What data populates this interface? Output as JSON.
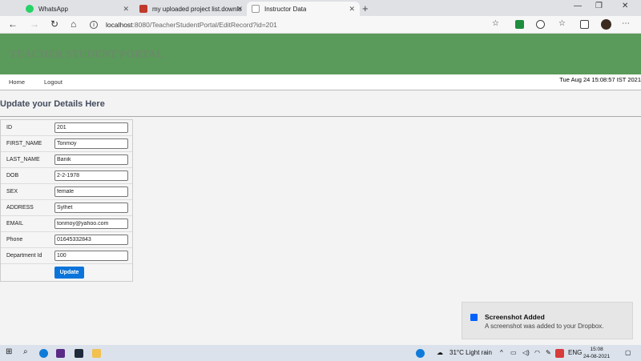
{
  "browser": {
    "tabs": [
      {
        "label": "WhatsApp",
        "icon": "whatsapp-icon",
        "color": "#25d366"
      },
      {
        "label": "my uploaded project list.downlo",
        "icon": "document-icon",
        "color": "#c0392b"
      },
      {
        "label": "Instructor Data",
        "icon": "page-icon",
        "color": "#999999"
      }
    ],
    "address": {
      "host": "localhost",
      "path": ":8080/TeacherStudentPortal/EditRecord?id=201"
    }
  },
  "page": {
    "banner_title": "TEACHER STUDENT PORTAL",
    "nav": {
      "home": "Home",
      "logout": "Logout"
    },
    "datetime": "Tue Aug 24 15:08:57 IST 2021",
    "heading": "Update your Details Here",
    "form": {
      "fields": [
        {
          "label": "ID",
          "value": "201"
        },
        {
          "label": "FIRST_NAME",
          "value": "Tonmoy"
        },
        {
          "label": "LAST_NAME",
          "value": "Banik"
        },
        {
          "label": "DOB",
          "value": "2-2-1978"
        },
        {
          "label": "SEX",
          "value": "female"
        },
        {
          "label": "ADDRESS",
          "value": "Sylhet"
        },
        {
          "label": "EMAIL",
          "value": "tonmoy@yahoo.com"
        },
        {
          "label": "Phone",
          "value": "01645332843"
        },
        {
          "label": "Department Id",
          "value": "100"
        }
      ],
      "submit_label": "Update"
    }
  },
  "toast": {
    "title": "Screenshot Added",
    "message": "A screenshot was added to your Dropbox."
  },
  "taskbar": {
    "weather": "31°C  Light rain",
    "language": "ENG",
    "time": "15:08",
    "date": "24-08-2021"
  }
}
